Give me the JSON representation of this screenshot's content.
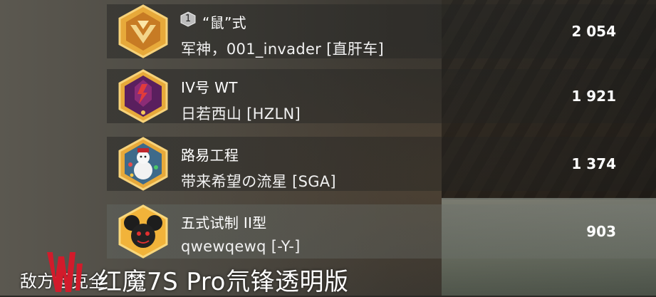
{
  "rows": [
    {
      "rank": "1",
      "vehicle": "“鼠”式",
      "player": "军神，001_invader [直肝车]",
      "score": "2 054",
      "badge": "gold-wings-badge-icon"
    },
    {
      "rank": "",
      "vehicle": "IV号 WT",
      "player": "日若西山 [HZLN]",
      "score": "1 921",
      "badge": "purple-emblem-badge-icon"
    },
    {
      "rank": "",
      "vehicle": "路易工程",
      "player": "带来希望の流星 [SGA]",
      "score": "1 374",
      "badge": "snowman-badge-icon"
    },
    {
      "rank": "",
      "vehicle": "五式试制 II型",
      "player": "qwewqewq [-Y-]",
      "score": "903",
      "badge": "mouse-ears-badge-icon"
    }
  ],
  "caption": "敌方坦克全",
  "watermark": "红魔7S Pro氘锋透明版",
  "colors": {
    "gold": "#e0a52a",
    "purple": "#6a2a6e",
    "accent_red": "#d21b2b"
  }
}
